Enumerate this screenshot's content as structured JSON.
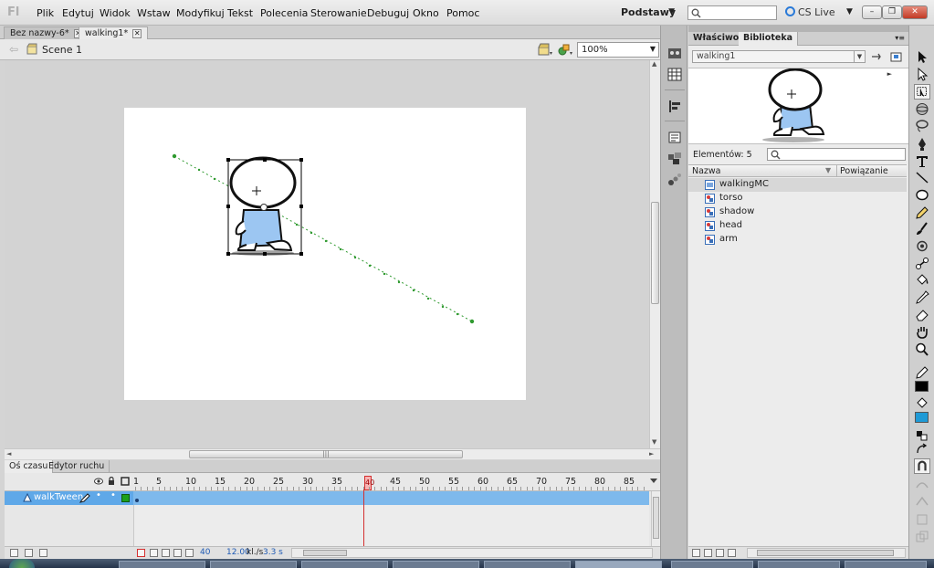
{
  "app": {
    "logo": "Fl"
  },
  "menu": [
    "Plik",
    "Edytuj",
    "Widok",
    "Wstaw",
    "Modyfikuj",
    "Tekst",
    "Polecenia",
    "Sterowanie",
    "Debuguj",
    "Okno",
    "Pomoc"
  ],
  "workspace": {
    "label": "Podstawy",
    "arrow": "▼"
  },
  "search": {
    "placeholder": ""
  },
  "cslive": {
    "label": "CS Live",
    "arrow": "▼"
  },
  "window_controls": {
    "minimize": "–",
    "restore": "❐",
    "close": "✕"
  },
  "doc_tabs": [
    {
      "label": "Bez nazwy-6*",
      "close": "✕"
    },
    {
      "label": "walking1*",
      "close": "✕"
    }
  ],
  "editbar": {
    "back": "⇦",
    "scene": "Scene 1",
    "zoom": "100%",
    "zoom_arrow": "▼"
  },
  "stage": {
    "colors": {
      "path": "#2f9a2f",
      "selection": "#000000",
      "body_fill": "#9cc6f2"
    }
  },
  "scroll": {
    "grip": "|||",
    "up": "▲",
    "down": "▼",
    "left": "◄",
    "right": "►"
  },
  "timeline": {
    "tabs": [
      "Oś czasu",
      "Edytor ruchu"
    ],
    "frame_numbers": [
      "1",
      "5",
      "10",
      "15",
      "20",
      "25",
      "30",
      "35",
      "40",
      "45",
      "50",
      "55",
      "60",
      "65",
      "70",
      "75",
      "80",
      "85"
    ],
    "playhead_frame": "40",
    "layer": {
      "name": "walkTween",
      "dot1": "•",
      "dot2": "•"
    },
    "footer": {
      "frame": "40",
      "fps": "12.00",
      "fps_unit": "kl./s",
      "time": "3.3 s"
    }
  },
  "panel": {
    "tabs": [
      "Właściwości",
      "Biblioteka"
    ],
    "menu_icon": "▾≡"
  },
  "library": {
    "document": "walking1",
    "count_label": "Elementów: 5",
    "columns": {
      "name": "Nazwa",
      "linkage": "Powiązanie",
      "sort": "▼"
    },
    "items": [
      {
        "name": "walkingMC",
        "type": "movieclip",
        "selected": true
      },
      {
        "name": "torso",
        "type": "graphic",
        "selected": false
      },
      {
        "name": "shadow",
        "type": "graphic",
        "selected": false
      },
      {
        "name": "head",
        "type": "graphic",
        "selected": false
      },
      {
        "name": "arm",
        "type": "graphic",
        "selected": false
      }
    ]
  },
  "colors": {
    "stroke": "#000000",
    "fill": "#1f9ad6",
    "layer_highlight": "#5fa8e8",
    "playhead": "#d43030"
  }
}
